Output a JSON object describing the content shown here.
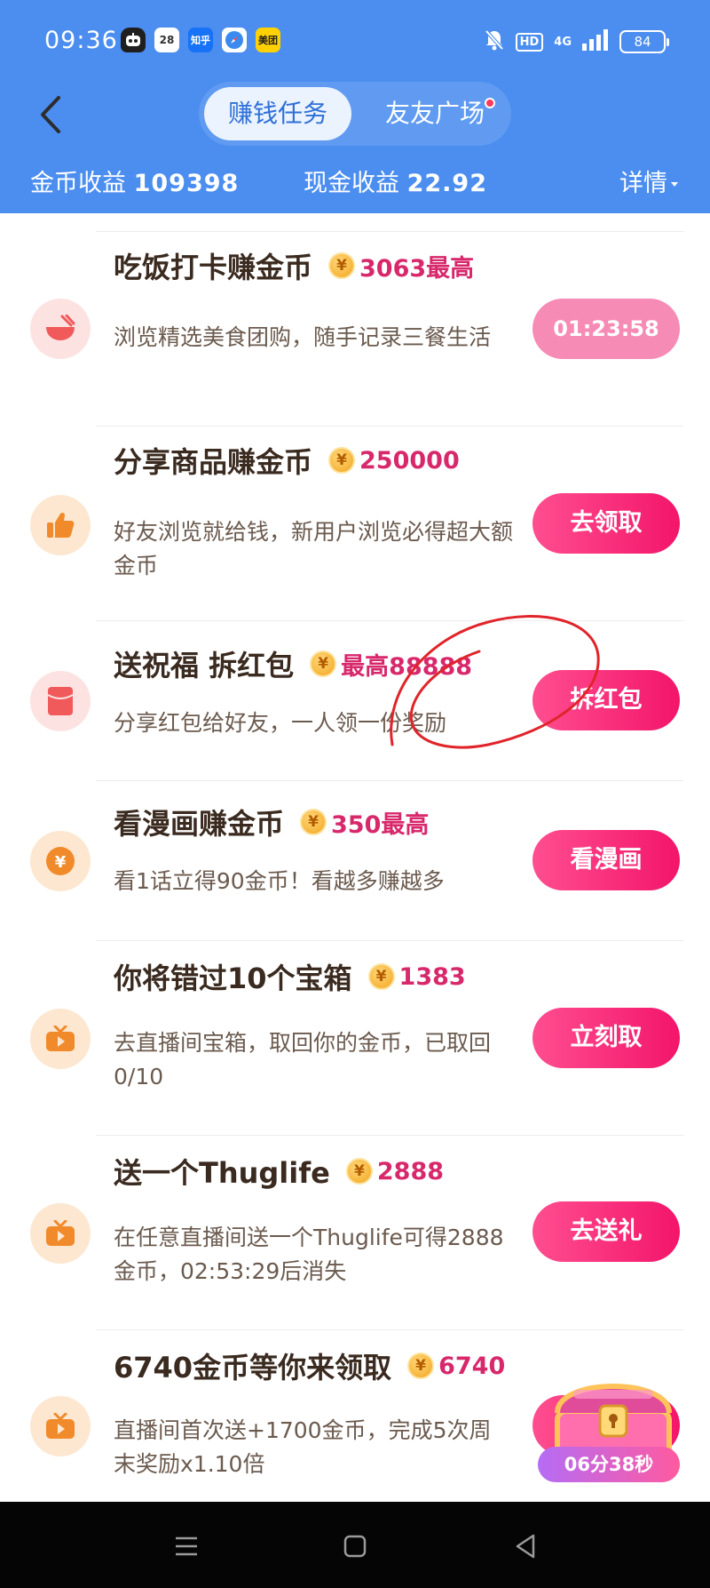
{
  "status_bar": {
    "time": "09:36",
    "calendar_day": "28",
    "zhihu_label": "知乎",
    "meituan_label": "美团",
    "hd_label": "HD",
    "network_label": "4G",
    "battery": "84"
  },
  "header": {
    "tabs": [
      {
        "label": "赚钱任务",
        "active": true
      },
      {
        "label": "友友广场",
        "active": false,
        "has_red_dot": true
      }
    ],
    "coin_earnings_label": "金币收益",
    "coin_earnings_value": "109398",
    "cash_earnings_label": "现金收益",
    "cash_earnings_value": "22.92",
    "detail_label": "详情",
    "background_color": "#4b8ef0"
  },
  "tasks": [
    {
      "title": "吃饭打卡赚金币",
      "reward": "3063最高",
      "description": "浏览精选美食团购，随手记录三餐生活",
      "button": "01:23:58",
      "icon": "rice-bowl-icon"
    },
    {
      "title": "分享商品赚金币",
      "reward": "250000",
      "description": "好友浏览就给钱，新用户浏览必得超大额金币",
      "button": "去领取",
      "icon": "thumbs-up-icon"
    },
    {
      "title": "送祝福 拆红包",
      "reward": "最高88888",
      "description": "分享红包给好友，一人领一份奖励",
      "button": "拆红包",
      "icon": "red-envelope-icon"
    },
    {
      "title": "看漫画赚金币",
      "reward": "350最高",
      "description": "看1话立得90金币！看越多赚越多",
      "button": "看漫画",
      "icon": "yuan-coin-icon"
    },
    {
      "title": "你将错过10个宝箱",
      "reward": "1383",
      "description": "去直播间宝箱，取回你的金币，已取回 0/10",
      "button": "立刻取",
      "icon": "live-tv-icon"
    },
    {
      "title": "送一个Thuglife",
      "reward": "2888",
      "description": "在任意直播间送一个Thuglife可得2888金币，02:53:29后消失",
      "button": "去送礼",
      "icon": "live-tv-icon"
    },
    {
      "title": "6740金币等你来领取",
      "reward": "6740",
      "description": "直播间首次送+1700金币，完成5次周末奖励x1.10倍",
      "button": "",
      "icon": "live-tv-icon"
    }
  ],
  "coin_symbol": "¥",
  "treasure_chest": {
    "timer": "06分38秒"
  },
  "colors": {
    "accent_pink": "#f3156a",
    "reward_text": "#d8286c",
    "timer_button": "#f68bb5"
  }
}
